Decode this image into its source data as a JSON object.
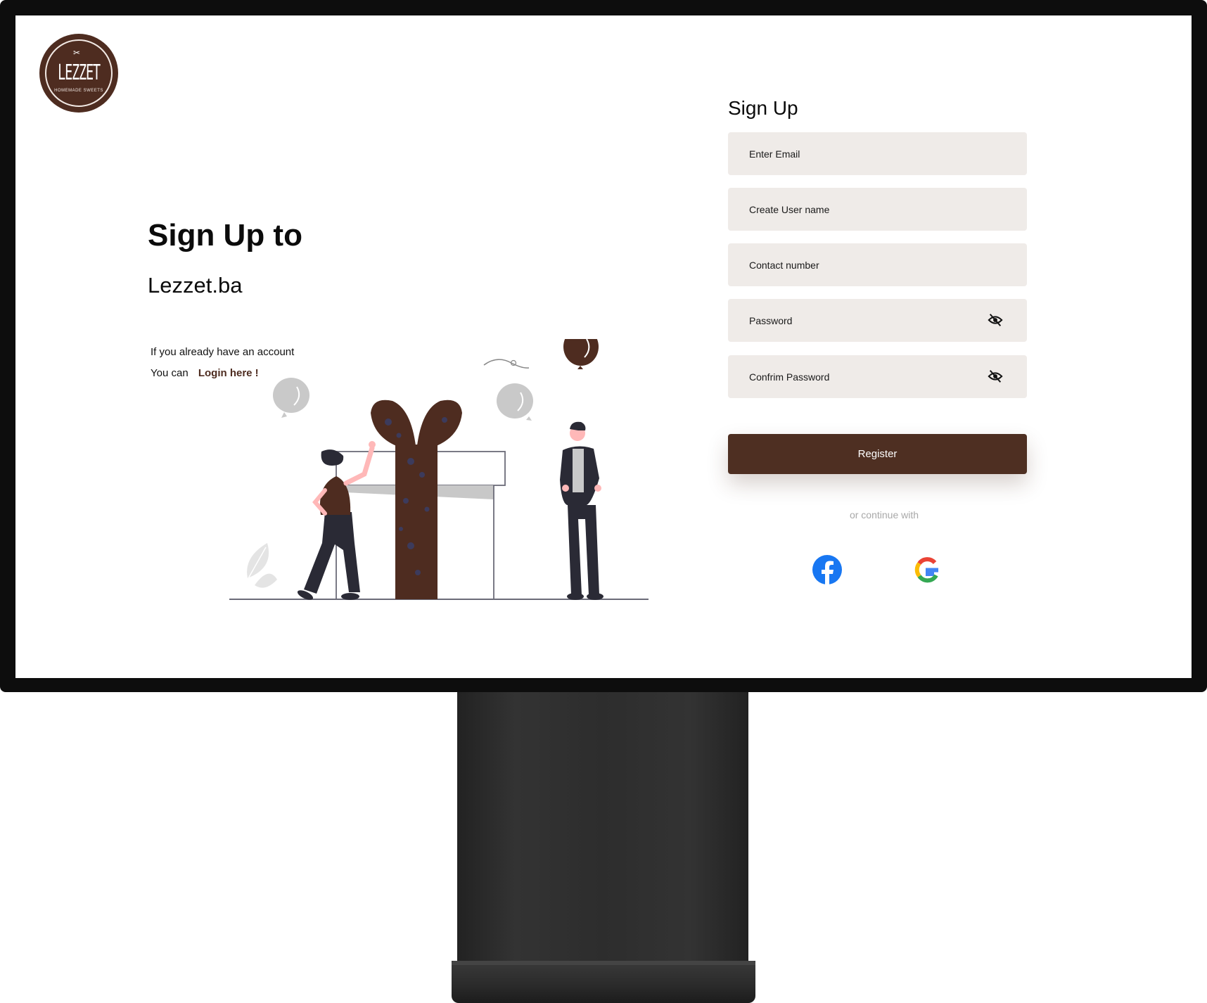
{
  "logo": {
    "text": "LEZZET",
    "subtext": "HOMEMADE SWEETS"
  },
  "left": {
    "headline": "Sign Up to",
    "brand": "Lezzet.ba",
    "account_note": "If you already have an account",
    "login_prefix": "You can",
    "login_link": "Login here !"
  },
  "form": {
    "title": "Sign Up",
    "email_placeholder": "Enter Email",
    "username_placeholder": "Create User name",
    "contact_placeholder": "Contact number",
    "password_placeholder": "Password",
    "confirm_placeholder": "Confrim Password",
    "register_label": "Register",
    "continue_text": "or continue with"
  },
  "icons": {
    "eye_toggle": "eye-off-icon",
    "social": [
      "facebook-icon",
      "google-icon"
    ]
  },
  "colors": {
    "brand": "#4e2f22",
    "field_bg": "#efebe8",
    "muted_text": "#a8a8a8",
    "facebook": "#1877f2"
  }
}
